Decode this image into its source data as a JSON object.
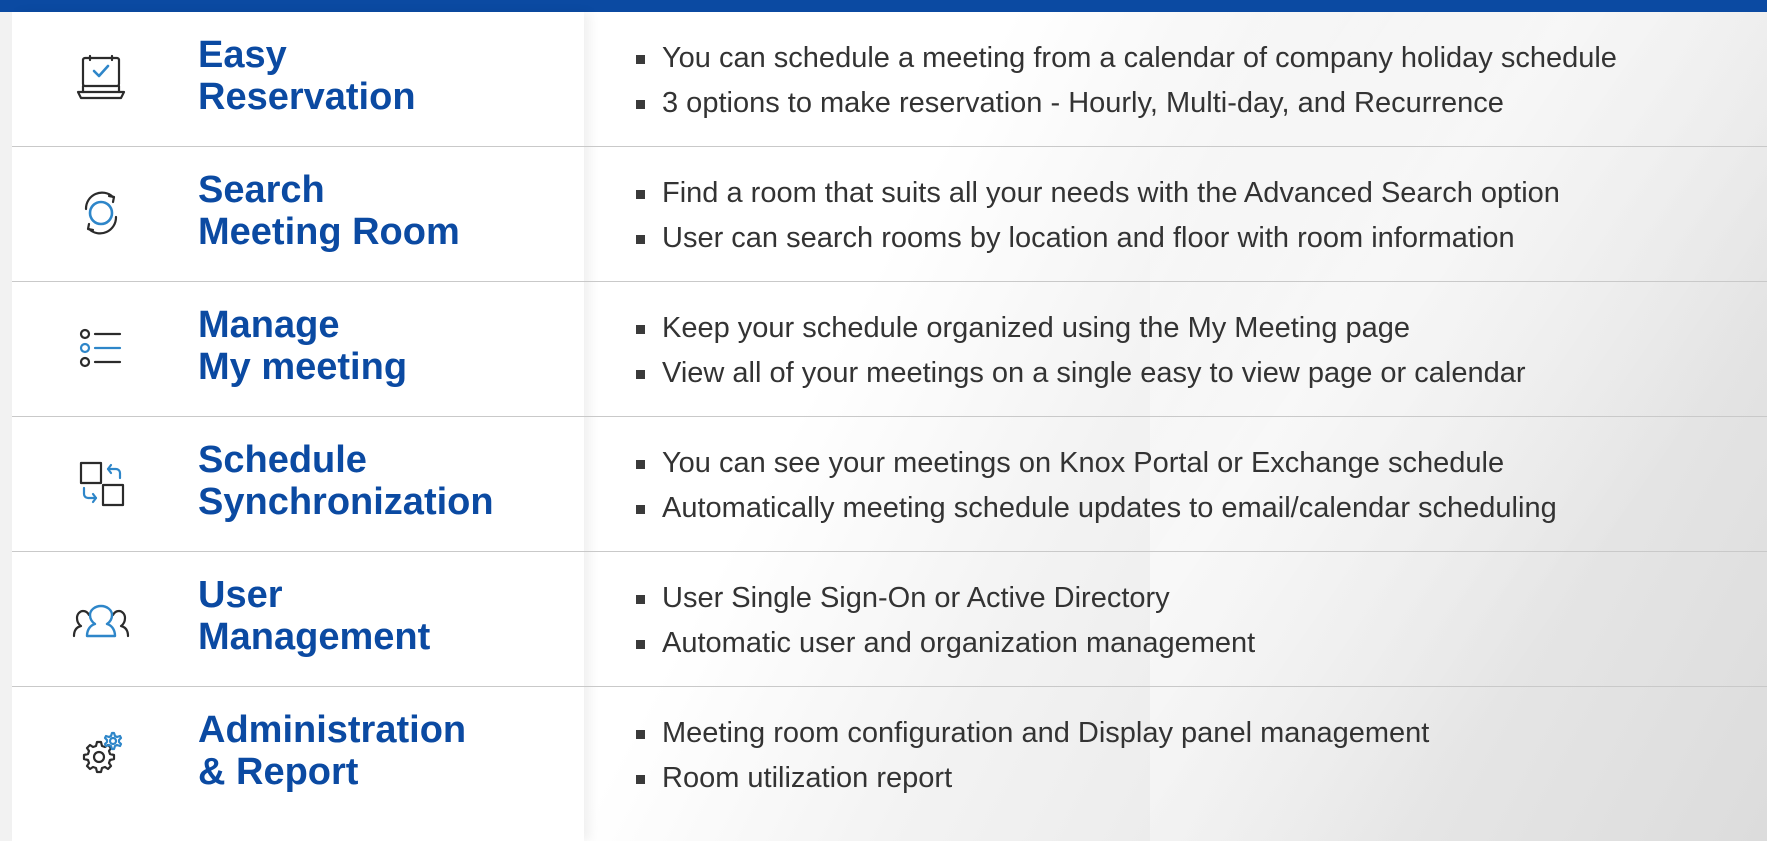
{
  "colors": {
    "accent": "#0b4aa2",
    "body_text": "#333333",
    "icon_stroke": "#2b2b2b",
    "icon_accent": "#2e86c9"
  },
  "features": [
    {
      "icon": "laptop-check-icon",
      "title_line1": "Easy",
      "title_line2": "Reservation",
      "bullets": [
        "You can schedule a meeting from a calendar of company holiday schedule",
        "3 options to make reservation - Hourly, Multi-day, and Recurrence"
      ]
    },
    {
      "icon": "sync-circle-icon",
      "title_line1": "Search",
      "title_line2": "Meeting Room",
      "bullets": [
        "Find a room that suits all your needs with the Advanced Search option",
        "User can search rooms by location and floor with room information"
      ]
    },
    {
      "icon": "list-icon",
      "title_line1": "Manage",
      "title_line2": "My meeting",
      "bullets": [
        "Keep your schedule organized using the My Meeting page",
        "View all of your meetings on a single easy to view page or calendar"
      ]
    },
    {
      "icon": "swap-squares-icon",
      "title_line1": "Schedule",
      "title_line2": "Synchronization",
      "bullets": [
        "You can see your meetings on Knox Portal or Exchange schedule",
        "Automatically meeting schedule updates to email/calendar scheduling"
      ]
    },
    {
      "icon": "users-group-icon",
      "title_line1": "User",
      "title_line2": "Management",
      "bullets": [
        "User Single Sign-On or Active Directory",
        "Automatic user and organization management"
      ]
    },
    {
      "icon": "gears-icon",
      "title_line1": "Administration",
      "title_line2": "& Report",
      "bullets": [
        "Meeting room configuration and Display panel management",
        "Room utilization report"
      ]
    }
  ]
}
